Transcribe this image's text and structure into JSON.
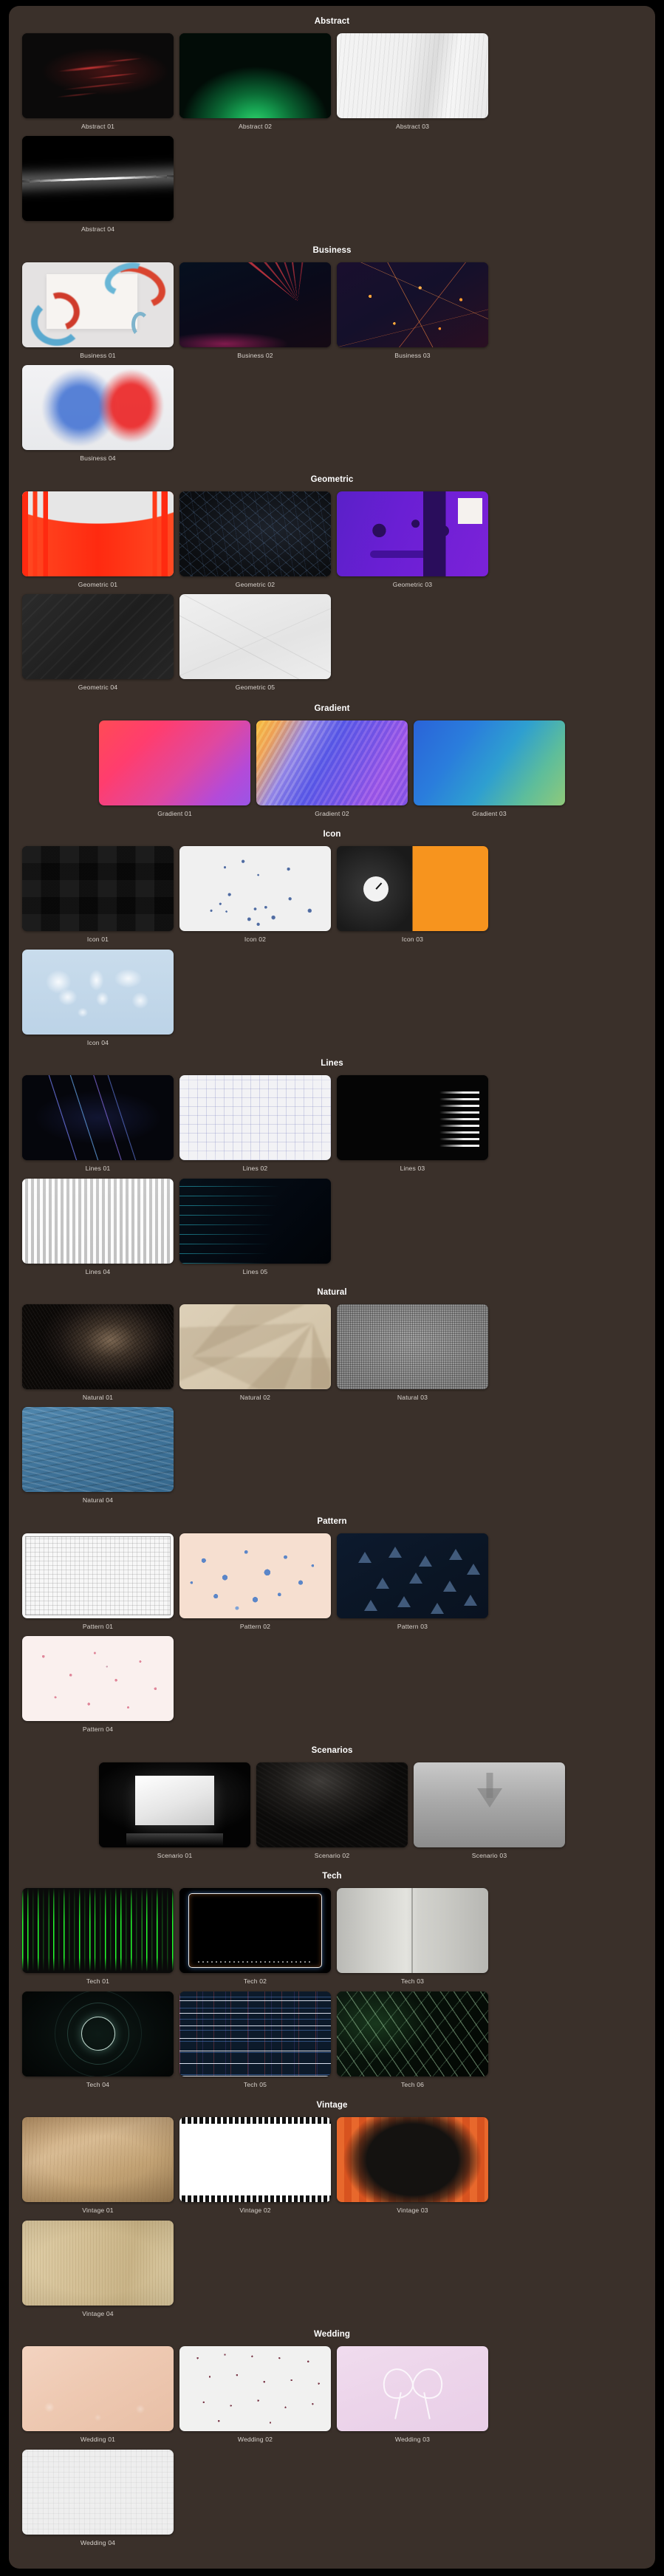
{
  "sections": [
    {
      "title": "Abstract",
      "centered": false,
      "items": [
        {
          "label": "Abstract 01",
          "art": "t-abstract01"
        },
        {
          "label": "Abstract 02",
          "art": "t-abstract02"
        },
        {
          "label": "Abstract 03",
          "art": "t-abstract03"
        },
        {
          "label": "Abstract 04",
          "art": "t-abstract04"
        }
      ]
    },
    {
      "title": "Business",
      "centered": false,
      "items": [
        {
          "label": "Business 01",
          "art": "t-business01"
        },
        {
          "label": "Business 02",
          "art": "t-business02"
        },
        {
          "label": "Business 03",
          "art": "t-business03"
        },
        {
          "label": "Business 04",
          "art": "t-business04"
        }
      ]
    },
    {
      "title": "Geometric",
      "centered": false,
      "items": [
        {
          "label": "Geometric 01",
          "art": "t-geo01"
        },
        {
          "label": "Geometric 02",
          "art": "t-geo02"
        },
        {
          "label": "Geometric 03",
          "art": "t-geo03"
        },
        {
          "label": "Geometric 04",
          "art": "t-geo04"
        },
        {
          "label": "Geometric 05",
          "art": "t-geo05"
        }
      ]
    },
    {
      "title": "Gradient",
      "centered": true,
      "items": [
        {
          "label": "Gradient 01",
          "art": "t-grad01"
        },
        {
          "label": "Gradient 02",
          "art": "t-grad02"
        },
        {
          "label": "Gradient 03",
          "art": "t-grad03"
        }
      ]
    },
    {
      "title": "Icon",
      "centered": false,
      "items": [
        {
          "label": "Icon 01",
          "art": "t-icon01"
        },
        {
          "label": "Icon 02",
          "art": "t-icon02"
        },
        {
          "label": "Icon 03",
          "art": "t-icon03"
        },
        {
          "label": "Icon 04",
          "art": "t-icon04"
        }
      ]
    },
    {
      "title": "Lines",
      "centered": false,
      "items": [
        {
          "label": "Lines 01",
          "art": "t-lines01"
        },
        {
          "label": "Lines 02",
          "art": "t-lines02"
        },
        {
          "label": "Lines 03",
          "art": "t-lines03"
        },
        {
          "label": "Lines 04",
          "art": "t-lines04"
        },
        {
          "label": "Lines 05",
          "art": "t-lines05"
        }
      ]
    },
    {
      "title": "Natural",
      "centered": false,
      "items": [
        {
          "label": "Natural 01",
          "art": "t-nat01"
        },
        {
          "label": "Natural 02",
          "art": "t-nat02"
        },
        {
          "label": "Natural 03",
          "art": "t-nat03"
        },
        {
          "label": "Natural 04",
          "art": "t-nat04"
        }
      ]
    },
    {
      "title": "Pattern",
      "centered": false,
      "items": [
        {
          "label": "Pattern 01",
          "art": "t-pat01"
        },
        {
          "label": "Pattern 02",
          "art": "t-pat02"
        },
        {
          "label": "Pattern 03",
          "art": "t-pat03"
        },
        {
          "label": "Pattern 04",
          "art": "t-pat04"
        }
      ]
    },
    {
      "title": "Scenarios",
      "centered": true,
      "items": [
        {
          "label": "Scenario 01",
          "art": "t-scen01"
        },
        {
          "label": "Scenario 02",
          "art": "t-scen02"
        },
        {
          "label": "Scenario 03",
          "art": "t-scen03"
        }
      ]
    },
    {
      "title": "Tech",
      "centered": false,
      "items": [
        {
          "label": "Tech 01",
          "art": "t-tech01"
        },
        {
          "label": "Tech 02",
          "art": "t-tech02"
        },
        {
          "label": "Tech 03",
          "art": "t-tech03"
        },
        {
          "label": "Tech 04",
          "art": "t-tech04"
        },
        {
          "label": "Tech 05",
          "art": "t-tech05"
        },
        {
          "label": "Tech 06",
          "art": "t-tech06"
        }
      ]
    },
    {
      "title": "Vintage",
      "centered": false,
      "items": [
        {
          "label": "Vintage 01",
          "art": "t-vin01"
        },
        {
          "label": "Vintage 02",
          "art": "t-vin02"
        },
        {
          "label": "Vintage 03",
          "art": "t-vin03"
        },
        {
          "label": "Vintage 04",
          "art": "t-vin04"
        }
      ]
    },
    {
      "title": "Wedding",
      "centered": false,
      "items": [
        {
          "label": "Wedding 01",
          "art": "t-wed01"
        },
        {
          "label": "Wedding 02",
          "art": "t-wed02"
        },
        {
          "label": "Wedding 03",
          "art": "t-wed03"
        },
        {
          "label": "Wedding 04",
          "art": "t-wed04"
        }
      ]
    }
  ],
  "colors": {
    "page_background": "#000000",
    "panel_background": "#3a302a",
    "section_title": "#ffffff",
    "card_label": "#d8d2cc"
  }
}
